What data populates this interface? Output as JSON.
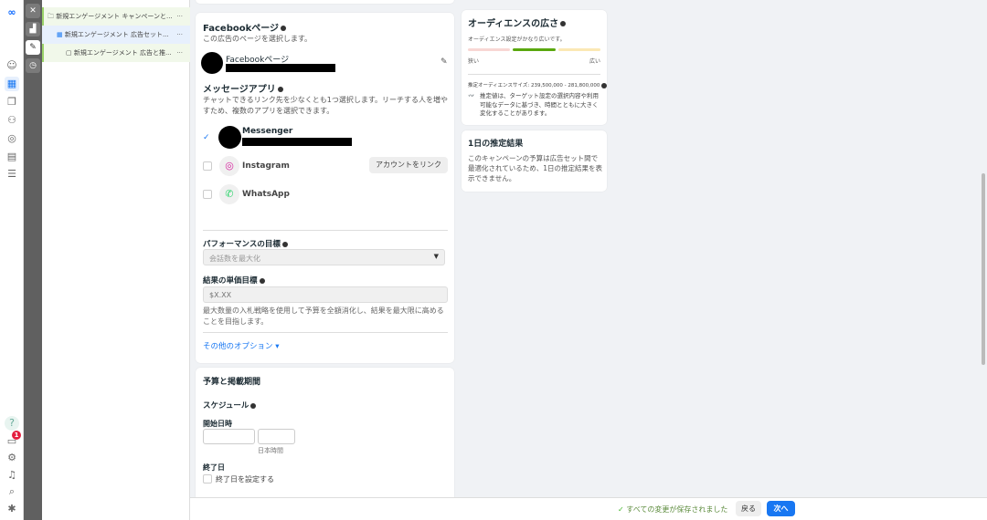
{
  "tree": {
    "items": [
      {
        "label": "新規エンゲージメント キャンペーンと...",
        "icon": "folder-icon"
      },
      {
        "label": "新規エンゲージメント 広告セット...",
        "icon": "grid-icon"
      },
      {
        "label": "新規エンゲージメント 広告と推...",
        "icon": "ad-icon"
      }
    ]
  },
  "notification_count": "1",
  "facebook_page": {
    "title": "Facebookページ",
    "desc": "この広告のページを選択します。",
    "name": "Facebookページ"
  },
  "messaging_apps": {
    "title": "メッセージアプリ",
    "desc": "チャットできるリンク先を少なくとも1つ選択します。リーチする人を増やすため、複数のアプリを選択できます。",
    "apps": [
      {
        "name": "Messenger",
        "checked": true
      },
      {
        "name": "Instagram",
        "checked": false,
        "action": "アカウントをリンク"
      },
      {
        "name": "WhatsApp",
        "checked": false
      }
    ]
  },
  "performance": {
    "title": "パフォーマンスの目標",
    "value": "会話数を最大化"
  },
  "cost_goal": {
    "title": "結果の単価目標",
    "placeholder": "$X.XX",
    "help": "最大数量の入札戦略を使用して予算を全額消化し、結果を最大限に高めることを目指します。"
  },
  "more_options": "その他のオプション",
  "budget": {
    "title": "予算と掲載期間",
    "schedule": "スケジュール",
    "start": "開始日時",
    "timezone": "日本時間",
    "end": "終了日",
    "end_checkbox": "終了日を設定する"
  },
  "audience": {
    "title": "オーディエンスの広さ",
    "status": "オーディエンス設定がかなり広いです。",
    "narrow": "狭い",
    "wide": "広い",
    "level": "middle",
    "size": "推定オーディエンスサイズ: 239,500,000 - 281,800,000",
    "note": "推定値は、ターゲット設定の選択内容や利用可能なデータに基づき、時間とともに大きく変化することがあります。",
    "colors": {
      "narrow": "#f8d7d4",
      "middle": "#5aa80f",
      "wide": "#fbe8b4"
    }
  },
  "daily": {
    "title": "1日の推定結果",
    "text": "このキャンペーンの予算は広告セット間で最適化されているため、1日の推定結果を表示できません。"
  },
  "footer": {
    "saved": "すべての変更が保存されました",
    "back": "戻る",
    "next": "次へ"
  },
  "colors": {
    "accent": "#1877f2",
    "saved": "#42b72a"
  }
}
